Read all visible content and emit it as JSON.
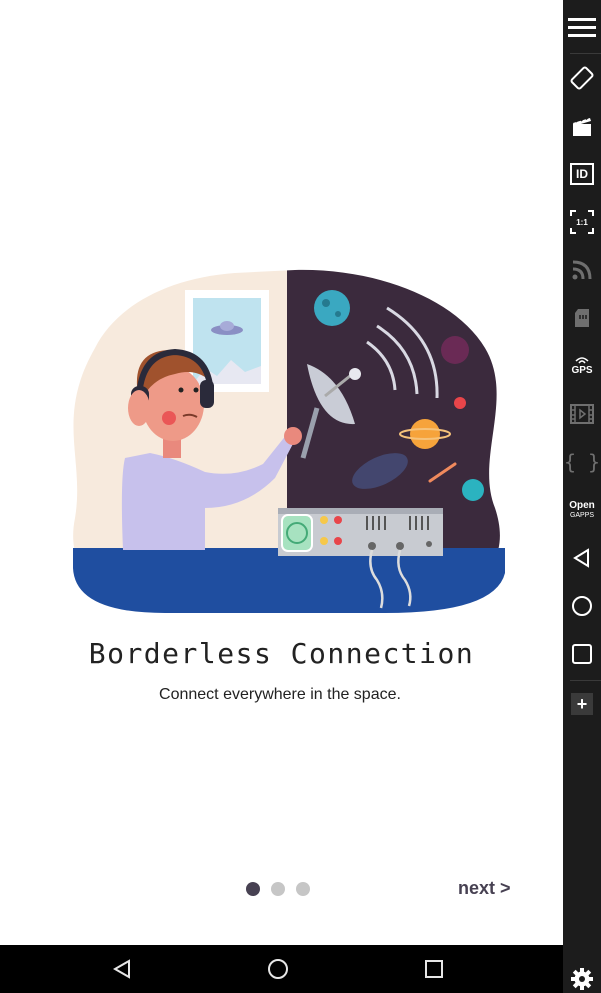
{
  "onboarding": {
    "title": "Borderless Connection",
    "subtitle": "Connect everywhere in the space.",
    "next_label": "next >",
    "page_indicator": {
      "total": 3,
      "current": 1
    }
  },
  "android_nav": {
    "buttons": [
      "back-icon",
      "home-icon",
      "recents-icon"
    ]
  },
  "emulator_toolbar": {
    "items": [
      {
        "icon": "menu-icon"
      },
      {
        "icon": "rotate-icon"
      },
      {
        "icon": "screencast-icon"
      },
      {
        "icon": "device-id-icon",
        "label": "ID"
      },
      {
        "icon": "pixel-perfect-icon",
        "label": "1:1"
      },
      {
        "icon": "wifi-signal-icon"
      },
      {
        "icon": "sd-card-icon"
      },
      {
        "icon": "gps-icon",
        "label": "GPS"
      },
      {
        "icon": "media-icon"
      },
      {
        "icon": "code-icon",
        "label": "{ }"
      },
      {
        "icon": "open-gapps-icon",
        "label": "Open",
        "sublabel": "GAPPS"
      },
      {
        "icon": "back-icon"
      },
      {
        "icon": "home-icon"
      },
      {
        "icon": "recents-icon"
      },
      {
        "icon": "add-icon",
        "label": "+"
      },
      {
        "icon": "gear-icon"
      }
    ]
  },
  "colors": {
    "indicator_active": "#474152",
    "indicator_inactive": "#c6c6c6",
    "toolbar_bg": "#1c1c1c",
    "navbar_bg": "#000000"
  }
}
